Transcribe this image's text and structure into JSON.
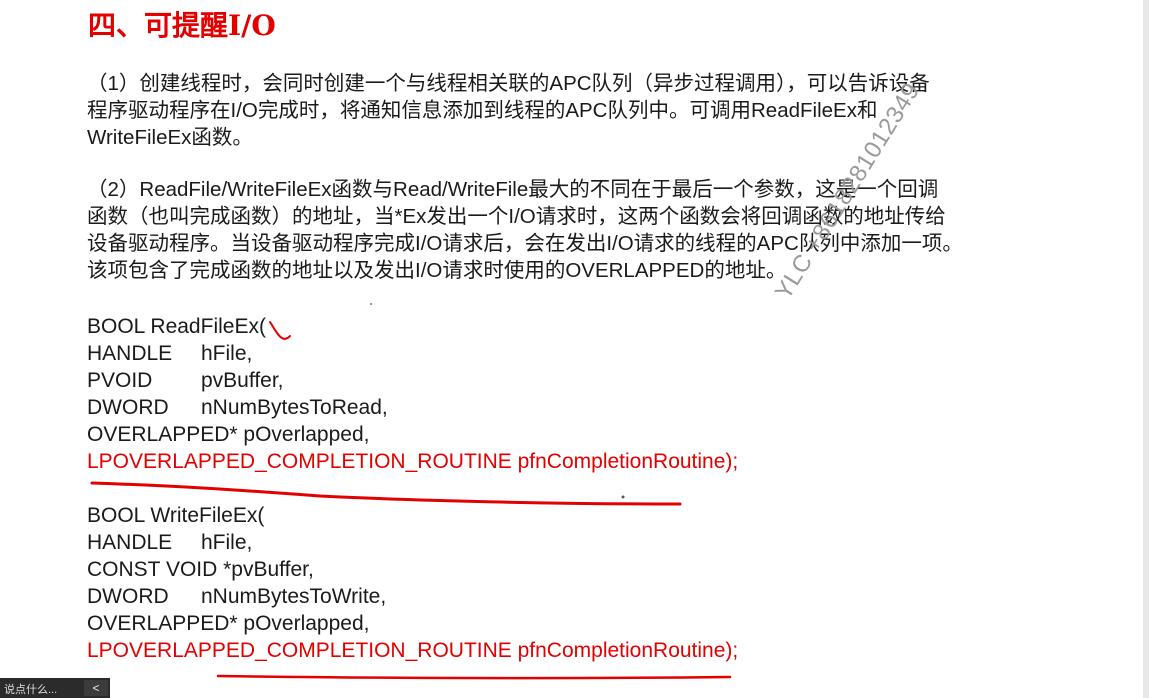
{
  "heading": "四、可提醒I/O",
  "paragraph1": [
    "（1）创建线程时，会同时创建一个与线程相关联的APC队列（异步过程调用），可以告诉设备",
    "程序驱动程序在I/O完成时，将通知信息添加到线程的APC队列中。可调用ReadFileEx和",
    "WriteFileEx函数。"
  ],
  "paragraph2": [
    "（2）ReadFile/WriteFileEx函数与Read/WriteFile最大的不同在于最后一个参数，这是一个回调",
    "函数（也叫完成函数）的地址，当*Ex发出一个I/O请求时，这两个函数会将回调函数的地址传给",
    "设备驱动程序。当设备驱动程序完成I/O请求后，会在发出I/O请求的线程的APC队列中添加一项。",
    "该项包含了完成函数的地址以及发出I/O请求时使用的OVERLAPPED的地址。"
  ],
  "code_readfileex": {
    "signature": "BOOL ReadFileEx(",
    "params": [
      {
        "type": "HANDLE",
        "name": "hFile,"
      },
      {
        "type": "PVOID",
        "name": "pvBuffer,"
      },
      {
        "type": "DWORD",
        "name": "nNumBytesToRead,"
      }
    ],
    "overlapped": "OVERLAPPED* pOverlapped,",
    "completion": "LPOVERLAPPED_COMPLETION_ROUTINE pfnCompletionRoutine);"
  },
  "code_writefileex": {
    "signature": "BOOL WriteFileEx(",
    "handle": {
      "type": "HANDLE",
      "name": "hFile,"
    },
    "const_void": "CONST VOID *pvBuffer,",
    "dword": {
      "type": "DWORD",
      "name": "nNumBytesToWrite,"
    },
    "overlapped": "OVERLAPPED* pOverlapped,",
    "completion": "LPOVERLAPPED_COMPLETION_ROUTINE pfnCompletionRoutine);"
  },
  "watermark": "YLC +8618281012349",
  "taskbar": {
    "say_text": "说点什么...",
    "back_label": "<"
  },
  "colors": {
    "heading": "#e30000",
    "highlight": "#e30000",
    "body_text": "#1a1a1a",
    "watermark": "#9a9a9a"
  }
}
